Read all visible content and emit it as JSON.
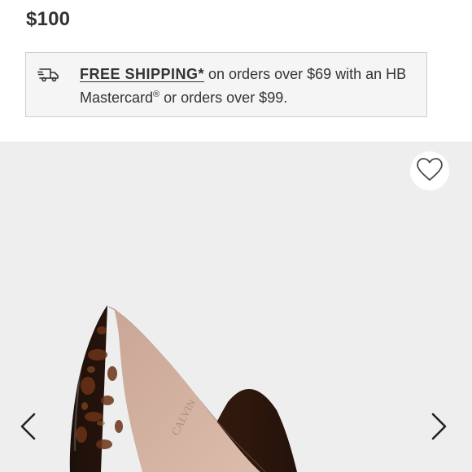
{
  "product": {
    "price": "$100"
  },
  "shipping": {
    "link_label": "FREE SHIPPING*",
    "text_part1": " on orders over $69 with an HB Mastercard",
    "registered_mark": "®",
    "text_part2": " or orders over $99.",
    "icon": "truck-icon"
  },
  "gallery": {
    "favorite_icon": "heart-outline-icon",
    "prev_icon": "chevron-left-icon",
    "next_icon": "chevron-right-icon",
    "image_subject": "tortoiseshell patent pointed-toe pump",
    "insole_brand_text": "CALVIN"
  },
  "colors": {
    "page_background": "#ffffff",
    "shipping_box_background": "#f5f5f5",
    "shipping_box_border": "#cfcfcf",
    "gallery_background": "#eeeeee",
    "text": "#333333"
  }
}
